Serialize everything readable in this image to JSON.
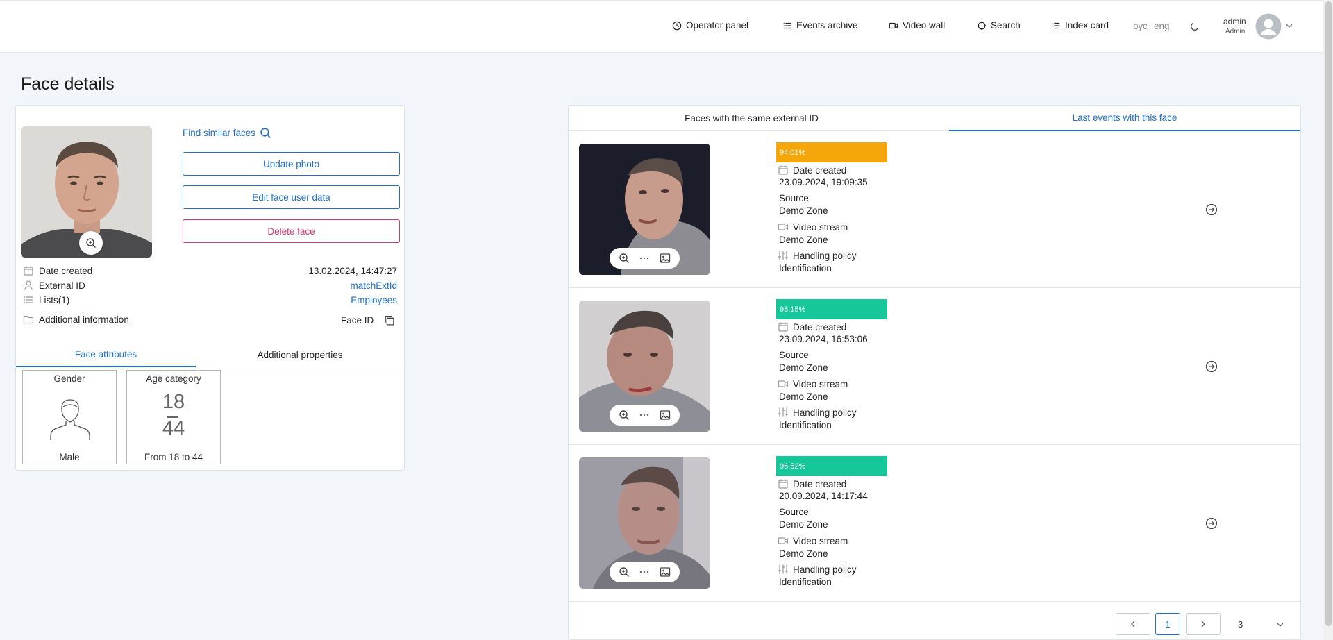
{
  "header": {
    "nav": [
      {
        "label": "Operator panel",
        "icon": "clock-icon"
      },
      {
        "label": "Events archive",
        "icon": "list-icon"
      },
      {
        "label": "Video wall",
        "icon": "camera-icon"
      },
      {
        "label": "Search",
        "icon": "crosshair-icon"
      },
      {
        "label": "Index card",
        "icon": "list-icon"
      }
    ],
    "lang_ru": "рус",
    "lang_en": "eng",
    "user_name": "admin",
    "user_role": "Admin"
  },
  "page_title": "Face details",
  "face": {
    "find_similar": "Find similar faces",
    "update_photo": "Update photo",
    "edit_user_data": "Edit face user data",
    "delete_face": "Delete face",
    "date_created_label": "Date created",
    "date_created": "13.02.2024, 14:47:27",
    "external_id_label": "External ID",
    "external_id": "matchExtId",
    "lists_label": "Lists(1)",
    "lists_value": "Employees",
    "additional_info": "Additional information",
    "face_id_label": "Face ID"
  },
  "left_tabs": {
    "attributes": "Face attributes",
    "additional": "Additional properties"
  },
  "attributes": {
    "gender_title": "Gender",
    "gender_value": "Male",
    "age_title": "Age category",
    "age_from": "18",
    "age_to": "44",
    "age_value": "From 18 to 44"
  },
  "right_tabs": {
    "same_external": "Faces with the same external ID",
    "last_events": "Last events with this face"
  },
  "events": [
    {
      "score": "94.01%",
      "score_color": "#f5a60b",
      "date_label": "Date created",
      "date": "23.09.2024, 19:09:35",
      "source_label": "Source",
      "source": "Demo Zone",
      "stream_label": "Video stream",
      "stream": "Demo Zone",
      "policy_label": "Handling policy",
      "policy": "Identification"
    },
    {
      "score": "98.15%",
      "score_color": "#16c79a",
      "date_label": "Date created",
      "date": "23.09.2024, 16:53:06",
      "source_label": "Source",
      "source": "Demo Zone",
      "stream_label": "Video stream",
      "stream": "Demo Zone",
      "policy_label": "Handling policy",
      "policy": "Identification"
    },
    {
      "score": "96.52%",
      "score_color": "#16c79a",
      "date_label": "Date created",
      "date": "20.09.2024, 14:17:44",
      "source_label": "Source",
      "source": "Demo Zone",
      "stream_label": "Video stream",
      "stream": "Demo Zone",
      "policy_label": "Handling policy",
      "policy": "Identification"
    }
  ],
  "pagination": {
    "current": "1",
    "per_page": "3"
  },
  "colors": {
    "accent": "#1e6fd0",
    "danger": "#d6376b"
  }
}
